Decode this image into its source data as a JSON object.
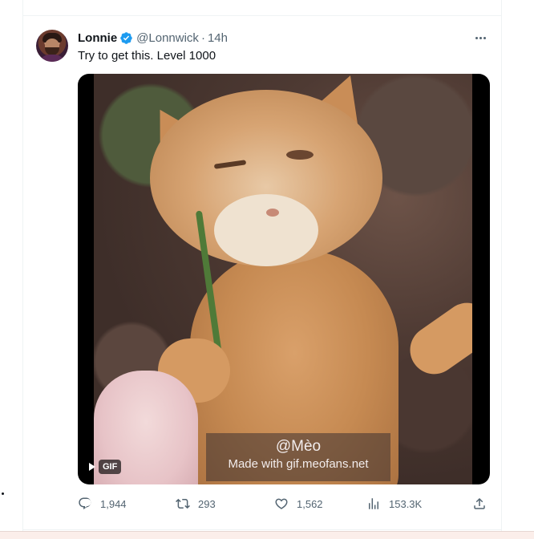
{
  "tweet": {
    "author": {
      "display_name": "Lonnie",
      "handle": "@Lonnwick",
      "verified": true,
      "avatar_icon": "profile-avatar"
    },
    "separator": "·",
    "timestamp": "14h",
    "text": "Try to get this. Level 1000",
    "media": {
      "type": "GIF",
      "badge_label": "GIF",
      "watermark_handle": "@Mèo",
      "watermark_credit": "Made with gif.meofans.net"
    },
    "actions": {
      "replies": "1,944",
      "retweets": "293",
      "likes": "1,562",
      "views": "153.3K"
    }
  },
  "colors": {
    "text_primary": "#0f1419",
    "text_secondary": "#536471",
    "verified_blue": "#1d9bf0",
    "divider": "#eff3f4"
  },
  "icons": [
    "verified-badge-icon",
    "more-icon",
    "play-icon",
    "reply-icon",
    "retweet-icon",
    "like-icon",
    "views-icon",
    "share-icon"
  ]
}
